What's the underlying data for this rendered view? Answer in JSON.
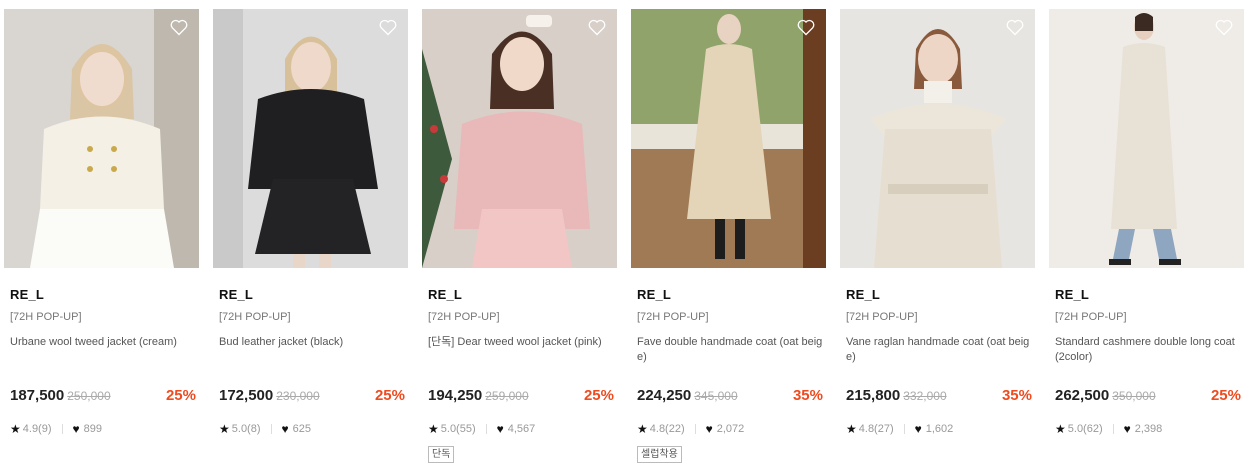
{
  "colors": {
    "discount": "#ef4b1f",
    "text": "#222222",
    "muted": "#999999"
  },
  "products": [
    {
      "brand": "RE_L",
      "tag": "[72H POP-UP]",
      "name": "Urbane wool tweed jacket (cream)",
      "price": "187,500",
      "original_price": "250,000",
      "discount": "25%",
      "rating": "4.9(9)",
      "likes": "899",
      "badge": ""
    },
    {
      "brand": "RE_L",
      "tag": "[72H POP-UP]",
      "name": "Bud leather jacket (black)",
      "price": "172,500",
      "original_price": "230,000",
      "discount": "25%",
      "rating": "5.0(8)",
      "likes": "625",
      "badge": ""
    },
    {
      "brand": "RE_L",
      "tag": "[72H POP-UP]",
      "name": "[단독] Dear tweed wool jacket (pink)",
      "price": "194,250",
      "original_price": "259,000",
      "discount": "25%",
      "rating": "5.0(55)",
      "likes": "4,567",
      "badge": "단독"
    },
    {
      "brand": "RE_L",
      "tag": "[72H POP-UP]",
      "name": "Fave double handmade coat (oat beige)",
      "price": "224,250",
      "original_price": "345,000",
      "discount": "35%",
      "rating": "4.8(22)",
      "likes": "2,072",
      "badge": "셀럽착용"
    },
    {
      "brand": "RE_L",
      "tag": "[72H POP-UP]",
      "name": "Vane raglan handmade coat (oat beige)",
      "price": "215,800",
      "original_price": "332,000",
      "discount": "35%",
      "rating": "4.8(27)",
      "likes": "1,602",
      "badge": ""
    },
    {
      "brand": "RE_L",
      "tag": "[72H POP-UP]",
      "name": "Standard cashmere double long coat (2color)",
      "price": "262,500",
      "original_price": "350,000",
      "discount": "25%",
      "rating": "5.0(62)",
      "likes": "2,398",
      "badge": ""
    }
  ]
}
